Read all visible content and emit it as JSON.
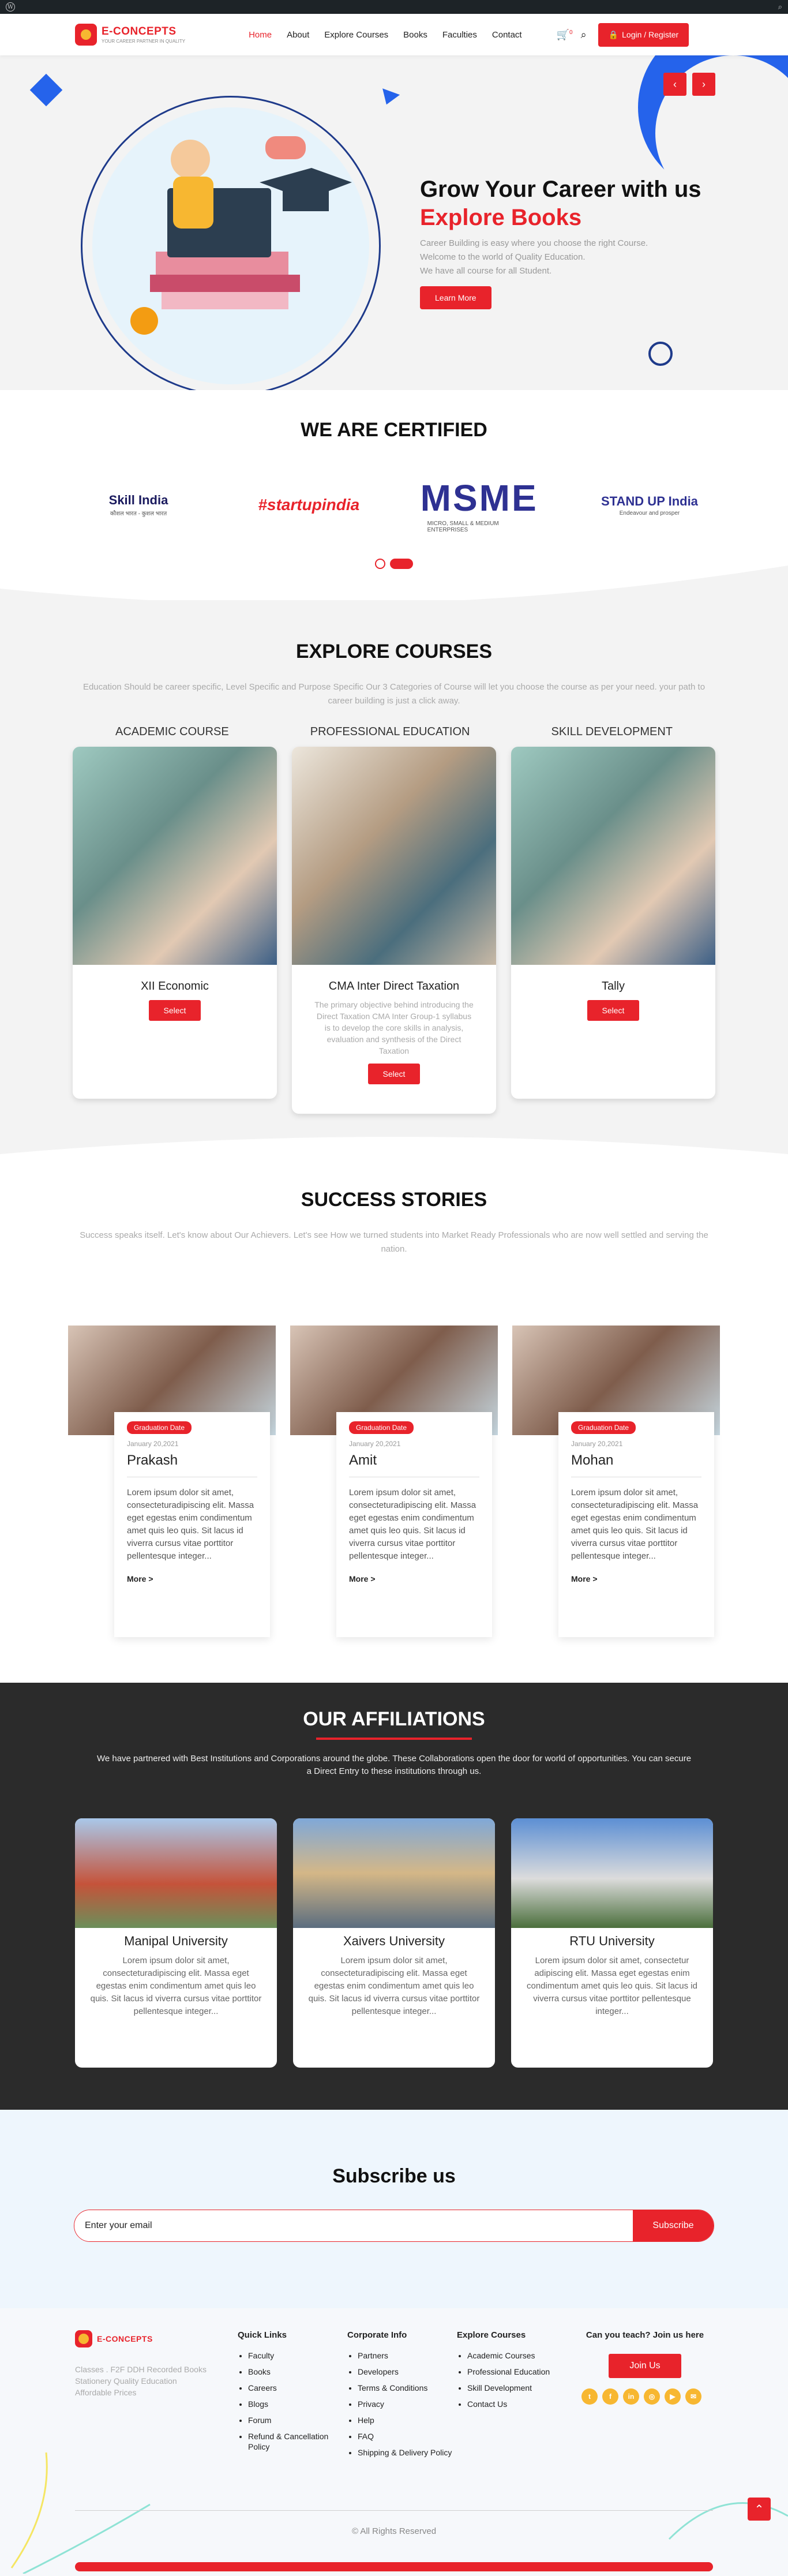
{
  "wp_bar": {
    "logo_glyph": "W",
    "search_glyph": "⌕"
  },
  "header": {
    "brand": "E-CONCEPTS",
    "tagline": "YOUR CAREER PARTNER IN QUALITY",
    "nav": [
      "Home",
      "About",
      "Explore Courses",
      "Books",
      "Faculties",
      "Contact"
    ],
    "cart_count": "0",
    "login_label": "Login / Register"
  },
  "hero": {
    "title_line1": "Grow Your Career with us",
    "title_line2": "Explore Books",
    "para": [
      "Career Building is easy where you choose the right Course.",
      "Welcome to the world of Quality Education.",
      "We have all course for all Student."
    ],
    "button": "Learn More",
    "arrow_left": "‹",
    "arrow_right": "›"
  },
  "certified": {
    "title": "WE ARE CERTIFIED",
    "logos": [
      {
        "name": "Skill India",
        "sub": "कौशल भारत - कुशल भारत"
      },
      {
        "name": "#startupindia",
        "sub": ""
      },
      {
        "name": "MSME",
        "sub": "MICRO, SMALL & MEDIUM ENTERPRISES"
      },
      {
        "name": "STAND UP India",
        "sub": "Endeavour and prosper"
      }
    ]
  },
  "courses": {
    "title": "EXPLORE COURSES",
    "intro": "Education Should be career specific, Level Specific and Purpose Specific Our 3 Categories of Course will let you choose the course as per your need. your path to career building is just a click away.",
    "headings": [
      "ACADEMIC COURSE",
      "PROFESSIONAL EDUCATION",
      "SKILL DEVELOPMENT"
    ],
    "cards": [
      {
        "name": "XII Economic",
        "desc": "",
        "button": "Select"
      },
      {
        "name": "CMA Inter Direct Taxation",
        "desc": "The primary objective behind introducing the Direct Taxation CMA Inter Group-1 syllabus is to develop the core skills in analysis, evaluation and synthesis of the Direct Taxation",
        "button": "Select"
      },
      {
        "name": "Tally",
        "desc": "",
        "button": "Select"
      }
    ]
  },
  "success": {
    "title": "SUCCESS STORIES",
    "intro": "Success speaks itself. Let's know about Our Achievers. Let's see How we turned students into Market Ready Professionals who are now well settled and serving the nation.",
    "stories": [
      {
        "badge": "Graduation Date",
        "date": "January 20,2021",
        "name": "Prakash",
        "text": "Lorem ipsum dolor sit amet, consecteturadipiscing elit. Massa eget egestas enim condimentum amet quis leo quis. Sit lacus id viverra cursus vitae porttitor pellentesque integer...",
        "more": "More >"
      },
      {
        "badge": "Graduation Date",
        "date": "January 20,2021",
        "name": "Amit",
        "text": "Lorem ipsum dolor sit amet, consecteturadipiscing elit. Massa eget egestas enim condimentum amet quis leo quis. Sit lacus id viverra cursus vitae porttitor pellentesque integer...",
        "more": "More >"
      },
      {
        "badge": "Graduation Date",
        "date": "January 20,2021",
        "name": "Mohan",
        "text": "Lorem ipsum dolor sit amet, consecteturadipiscing elit. Massa eget egestas enim condimentum amet quis leo quis. Sit lacus id viverra cursus vitae porttitor pellentesque integer...",
        "more": "More >"
      }
    ]
  },
  "affiliations": {
    "title": "OUR AFFILIATIONS",
    "intro": "We have partnered with Best Institutions and Corporations around the globe. These Collaborations open the door for world of opportunities. You can secure a Direct Entry to these institutions through us.",
    "cards": [
      {
        "name": "Manipal University",
        "text": "Lorem ipsum dolor sit amet, consecteturadipiscing elit. Massa eget egestas enim condimentum amet quis leo quis. Sit lacus id viverra cursus vitae porttitor pellentesque integer..."
      },
      {
        "name": "Xaivers University",
        "text": "Lorem ipsum dolor sit amet, consecteturadipiscing elit. Massa eget egestas enim condimentum amet quis leo quis. Sit lacus id viverra cursus vitae porttitor pellentesque integer..."
      },
      {
        "name": "RTU University",
        "text": "Lorem ipsum dolor sit amet, consectetur adipiscing elit. Massa eget egestas enim condimentum amet quis leo quis. Sit lacus id viverra cursus vitae porttitor pellentesque integer..."
      }
    ]
  },
  "subscribe": {
    "title": "Subscribe us",
    "placeholder": "Enter your email",
    "button": "Subscribe"
  },
  "footer": {
    "brand": "E-CONCEPTS",
    "brand_text": [
      "Classes . F2F DDH Recorded Books",
      "Stationery Quality Education",
      "Affordable Prices"
    ],
    "quick_links": {
      "title": "Quick Links",
      "items": [
        "Faculty",
        "Books",
        "Careers",
        "Blogs",
        "Forum",
        "Refund & Cancellation Policy"
      ]
    },
    "corporate": {
      "title": "Corporate Info",
      "items": [
        "Partners",
        "Developers",
        "Terms & Conditions",
        "Privacy",
        "Help",
        "FAQ",
        "Shipping & Delivery Policy"
      ]
    },
    "explore": {
      "title": "Explore Courses",
      "items": [
        "Academic Courses",
        "Professional Education",
        "Skill Development",
        "Contact Us"
      ]
    },
    "teach": {
      "title": "Can you teach? Join us here",
      "button": "Join Us"
    },
    "socials": [
      "twitter-icon",
      "facebook-icon",
      "linkedin-icon",
      "instagram-icon",
      "youtube-icon",
      "other-icon"
    ],
    "copyright": "© All Rights Reserved"
  },
  "colors": {
    "accent": "#e8232b",
    "blue": "#2563eb",
    "navy": "#1e3a8a",
    "dark": "#2b2b2b",
    "yellow": "#f7b731"
  }
}
